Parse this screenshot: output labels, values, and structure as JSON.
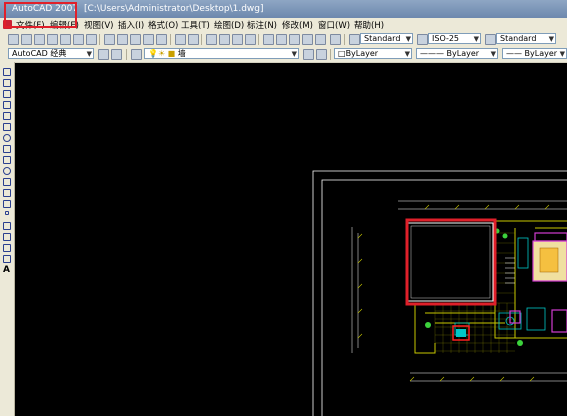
{
  "title": {
    "app": "AutoCAD 2007",
    "separator": "-",
    "document": "[C:\\Users\\Administrator\\Desktop\\1.dwg]"
  },
  "menu": [
    {
      "label": "文件(F)"
    },
    {
      "label": "编辑(E)"
    },
    {
      "label": "视图(V)"
    },
    {
      "label": "插入(I)"
    },
    {
      "label": "格式(O)"
    },
    {
      "label": "工具(T)"
    },
    {
      "label": "绘图(D)"
    },
    {
      "label": "标注(N)"
    },
    {
      "label": "修改(M)"
    },
    {
      "label": "窗口(W)"
    },
    {
      "label": "帮助(H)"
    }
  ],
  "styles": {
    "text_style": "Standard",
    "dim_style": "ISO-25",
    "table_style": "Standard"
  },
  "workspace": {
    "value": "AutoCAD 经典"
  },
  "layers": {
    "current": "墙"
  },
  "properties": {
    "color": "ByLayer",
    "linetype": "ByLayer",
    "lineweight": "ByLayer"
  },
  "colors": {
    "highlight": "#e0202a",
    "canvas": "#000000",
    "drawing_lines": "#ffffff",
    "walls": "#c8c800",
    "furniture": "#00c8c8",
    "accent_magenta": "#d23cd2",
    "accent_red": "#ff2020",
    "accent_green": "#3cd23c"
  }
}
